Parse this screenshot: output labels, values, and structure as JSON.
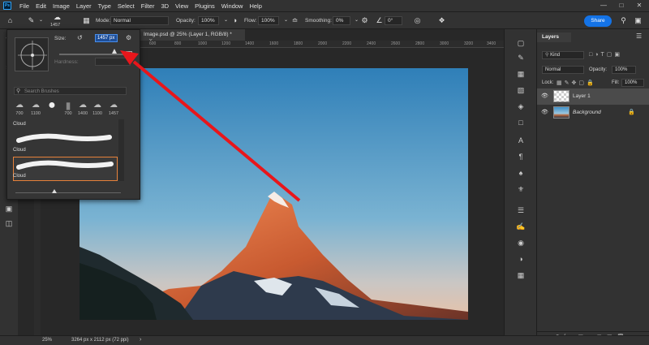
{
  "menubar": {
    "logo": "Ps",
    "items": [
      "File",
      "Edit",
      "Image",
      "Layer",
      "Type",
      "Select",
      "Filter",
      "3D",
      "View",
      "Plugins",
      "Window",
      "Help"
    ]
  },
  "options": {
    "brush_size": "1457",
    "mode_label": "Mode:",
    "mode_value": "Normal",
    "opacity_label": "Opacity:",
    "opacity_value": "100%",
    "flow_label": "Flow:",
    "flow_value": "100%",
    "smoothing_label": "Smoothing:",
    "smoothing_value": "0%",
    "angle_value": "0°",
    "share_label": "Share"
  },
  "document": {
    "tab_title": "Image.psd @ 25% (Layer 1, RGB/8) *",
    "ruler_ticks": [
      "600",
      "800",
      "1000",
      "1200",
      "1400",
      "1600",
      "1800",
      "2000",
      "2200",
      "2400",
      "2600",
      "2800",
      "3000",
      "3200",
      "3400"
    ]
  },
  "brush_panel": {
    "size_label": "Size:",
    "size_value": "1457 px",
    "hardness_label": "Hardness:",
    "search_placeholder": "Search Brushes",
    "thumb_numbers": [
      "700",
      "1100",
      "",
      "700",
      "1400",
      "1100",
      "1457"
    ],
    "presets": [
      "Cloud",
      "Cloud",
      "Cloud"
    ]
  },
  "layers_panel": {
    "tab": "Layers",
    "kind_value": "Kind",
    "blend_value": "Normal",
    "opacity_label": "Opacity:",
    "opacity_value": "100%",
    "lock_label": "Lock:",
    "fill_label": "Fill:",
    "fill_value": "100%",
    "layers": [
      {
        "name": "Layer 1"
      },
      {
        "name": "Background"
      }
    ]
  },
  "status": {
    "zoom": "25%",
    "doc_info": "3264 px x 2112 px (72 ppi)"
  },
  "colors": {
    "accent": "#1473e6",
    "selection_border": "#e6813a",
    "arrow": "#e8161b"
  }
}
